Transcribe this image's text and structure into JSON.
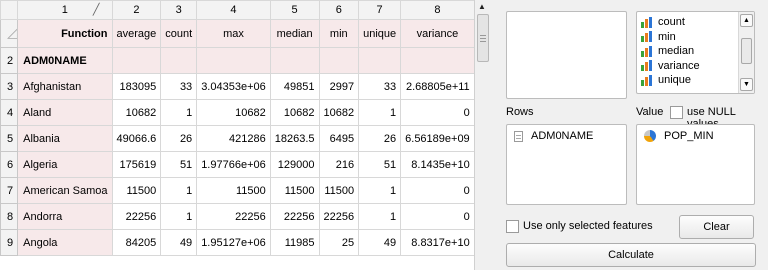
{
  "table": {
    "columns": [
      "1",
      "2",
      "3",
      "4",
      "5",
      "6",
      "7",
      "8"
    ],
    "function_label": "Function",
    "functions": [
      "average",
      "count",
      "max",
      "median",
      "min",
      "unique",
      "variance"
    ],
    "group_field": "ADM0NAME",
    "row_numbers": [
      "1",
      "2",
      "3",
      "4",
      "5",
      "6",
      "7",
      "8",
      "9"
    ],
    "rows": [
      {
        "name": "Afghanistan",
        "values": [
          "183095",
          "33",
          "3.04353e+06",
          "49851",
          "2997",
          "33",
          "2.68805e+11"
        ]
      },
      {
        "name": "Aland",
        "values": [
          "10682",
          "1",
          "10682",
          "10682",
          "10682",
          "1",
          "0"
        ]
      },
      {
        "name": "Albania",
        "values": [
          "49066.6",
          "26",
          "421286",
          "18263.5",
          "6495",
          "26",
          "6.56189e+09"
        ]
      },
      {
        "name": "Algeria",
        "values": [
          "175619",
          "51",
          "1.97766e+06",
          "129000",
          "216",
          "51",
          "8.1435e+10"
        ]
      },
      {
        "name": "American Samoa",
        "values": [
          "11500",
          "1",
          "11500",
          "11500",
          "11500",
          "1",
          "0"
        ]
      },
      {
        "name": "Andorra",
        "values": [
          "22256",
          "1",
          "22256",
          "22256",
          "22256",
          "1",
          "0"
        ]
      },
      {
        "name": "Angola",
        "values": [
          "84205",
          "49",
          "1.95127e+06",
          "11985",
          "25",
          "49",
          "8.8317e+10"
        ]
      }
    ]
  },
  "panel": {
    "values_list": [
      "count",
      "min",
      "median",
      "variance",
      "unique"
    ],
    "rows_label": "Rows",
    "value_label": "Value",
    "null_label": "use NULL values",
    "rows_field": "ADM0NAME",
    "value_field": "POP_MIN",
    "selected_only_label": "Use only selected features",
    "clear_label": "Clear",
    "calculate_label": "Calculate"
  },
  "colors": {
    "row_header_pink": "#f7e9ea",
    "bar_green": "#3aa33a",
    "bar_orange": "#e87d1e",
    "bar_blue": "#2b75d6"
  },
  "icons": [
    "bar-chart-icon",
    "document-icon",
    "pie-chart-icon",
    "scroll-up-icon",
    "scroll-down-icon"
  ]
}
